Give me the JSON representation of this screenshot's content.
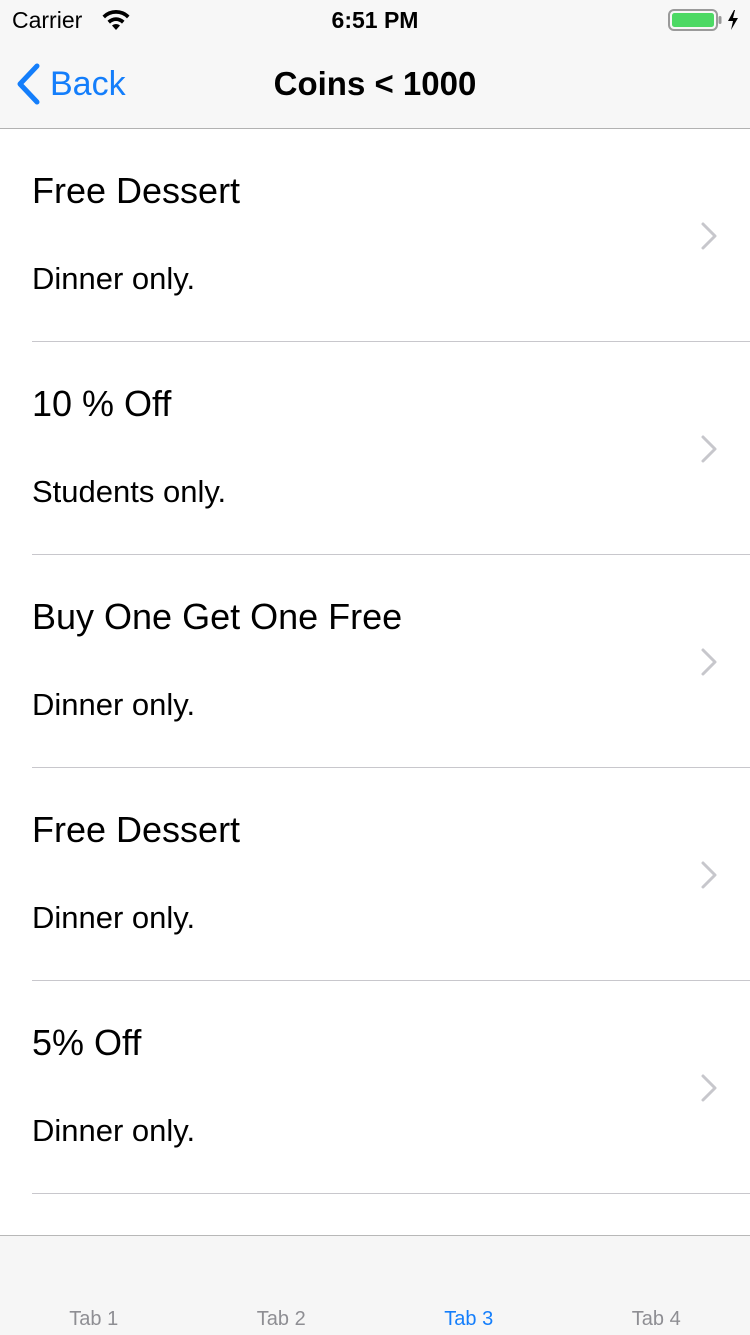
{
  "status_bar": {
    "carrier": "Carrier",
    "time": "6:51 PM",
    "battery_color": "#4cd964"
  },
  "nav": {
    "back_label": "Back",
    "title": "Coins < 1000",
    "accent_color": "#147efb"
  },
  "list": {
    "items": [
      {
        "title": "Free Dessert",
        "subtitle": "Dinner only."
      },
      {
        "title": "10 % Off",
        "subtitle": "Students only."
      },
      {
        "title": "Buy One Get One Free",
        "subtitle": "Dinner only."
      },
      {
        "title": "Free Dessert",
        "subtitle": "Dinner only."
      },
      {
        "title": "5% Off",
        "subtitle": "Dinner only."
      }
    ]
  },
  "tab_bar": {
    "selected_index": 2,
    "tabs": [
      {
        "label": "Tab 1"
      },
      {
        "label": "Tab 2"
      },
      {
        "label": "Tab 3"
      },
      {
        "label": "Tab 4"
      }
    ]
  }
}
